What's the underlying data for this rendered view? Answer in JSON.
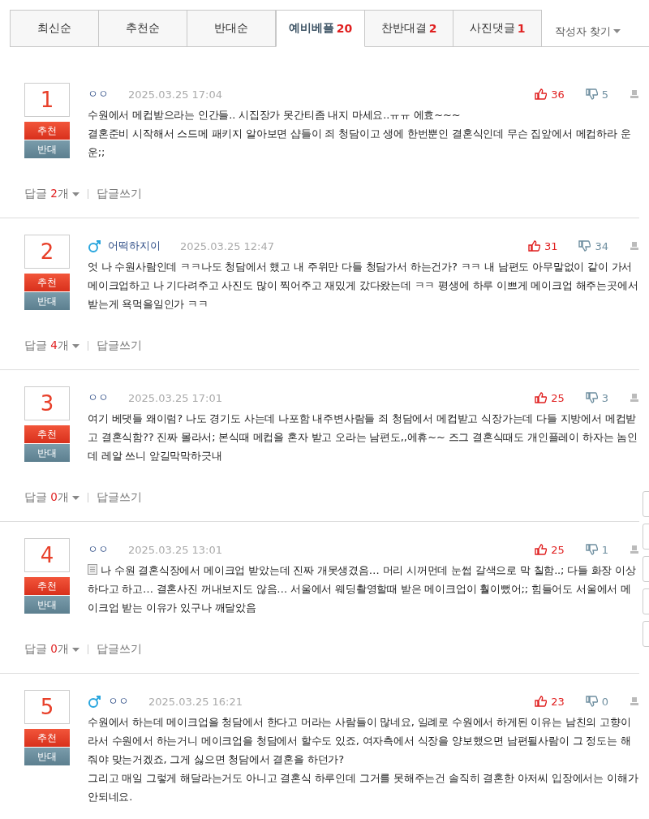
{
  "tabs": [
    {
      "label": "최신순",
      "selected": false
    },
    {
      "label": "추천순",
      "selected": false
    },
    {
      "label": "반대순",
      "selected": false
    },
    {
      "label": "예비베플",
      "count": "20",
      "selected": true
    },
    {
      "label": "찬반대결",
      "count": "2",
      "selected": false
    },
    {
      "label": "사진댓글",
      "count": "1",
      "selected": false
    }
  ],
  "author_search": {
    "label": "작성자 찾기"
  },
  "comments": [
    {
      "rank": "1",
      "upvote_label": "추천",
      "downvote_label": "반대",
      "male": false,
      "nickname": "ㅇㅇ",
      "date": "2025.03.25 17:04",
      "likes": "36",
      "dislikes": "5",
      "attachment": false,
      "paragraphs": [
        "수원에서 메컵받으라는 인간들.. 시집장가 못간티좀 내지 마세요..ㅠㅠ 에효~~~",
        "결혼준비 시작해서 스드메 패키지 알아보면 샵들이 죄 청담이고 생에 한번뿐인 결혼식인데 무슨 집앞에서 메컵하라 운운;;"
      ],
      "reply_label": "답글",
      "reply_count": "2",
      "reply_unit": "개",
      "write_reply": "답글쓰기"
    },
    {
      "rank": "2",
      "upvote_label": "추천",
      "downvote_label": "반대",
      "male": true,
      "nickname": "어떡하지이",
      "date": "2025.03.25 12:47",
      "likes": "31",
      "dislikes": "34",
      "attachment": false,
      "paragraphs": [
        "엇 나 수원사람인데 ㅋㅋ나도 청담에서 했고 내 주위만 다들 청담가서 하는건가? ㅋㅋ 내 남편도 아무말없이 같이 가서 메이크업하고 나 기다려주고 사진도 많이 찍어주고 재밌게 갔다왔는데 ㅋㅋ 평생에 하루 이쁘게 메이크업 해주는곳에서 받는게 욕먹을일인가 ㅋㅋ"
      ],
      "reply_label": "답글",
      "reply_count": "4",
      "reply_unit": "개",
      "write_reply": "답글쓰기"
    },
    {
      "rank": "3",
      "upvote_label": "추천",
      "downvote_label": "반대",
      "male": false,
      "nickname": "ㅇㅇ",
      "date": "2025.03.25 17:01",
      "likes": "25",
      "dislikes": "3",
      "attachment": false,
      "paragraphs": [
        "여기 베댓들 왜이럼? 나도 경기도 사는데 나포함 내주변사람들 죄 청담에서 메컵받고 식장가는데 다들 지방에서 메컵받고 결혼식함?? 진짜 몰라서; 본식때 메컵을 혼자 받고 오라는 남편도,,에휴~~ 즈그 결혼식때도 개인플레이 하자는 놈인데 레알 쓰니 앞길막막하긋내"
      ],
      "reply_label": "답글",
      "reply_count": "0",
      "reply_unit": "개",
      "write_reply": "답글쓰기"
    },
    {
      "rank": "4",
      "upvote_label": "추천",
      "downvote_label": "반대",
      "male": false,
      "nickname": "ㅇㅇ",
      "date": "2025.03.25 13:01",
      "likes": "25",
      "dislikes": "1",
      "attachment": true,
      "paragraphs": [
        "나 수원 결혼식장에서 메이크업 받았는데 진짜 개못생겼음… 머리 시꺼먼데 눈썹 갈색으로 막 칠함..; 다들 화장 이상하다고 하고… 결혼사진 꺼내보지도 않음… 서울에서 웨딩촬영할때 받은 메이크업이 훨이뻤어;; 힘들어도 서울에서 메이크업 받는 이유가 있구나 깨달았음"
      ],
      "reply_label": "답글",
      "reply_count": "0",
      "reply_unit": "개",
      "write_reply": "답글쓰기"
    },
    {
      "rank": "5",
      "upvote_label": "추천",
      "downvote_label": "반대",
      "male": true,
      "nickname": "ㅇㅇ",
      "date": "2025.03.25 16:21",
      "likes": "23",
      "dislikes": "0",
      "attachment": false,
      "paragraphs": [
        "수원에서 하는데 메이크업을 청담에서 한다고 머라는 사람들이 많네요, 일례로 수원에서 하게된 이유는 남친의 고향이라서 수원에서 하는거니 메이크업을 청담에서 할수도 있죠, 여자측에서 식장을 양보했으면 남편될사람이 그 정도는 해줘야 맞는거겠죠, 그게 싫으면 청담에서 결혼을 하던가?",
        "그리고 매일 그렇게 해달라는거도 아니고 결혼식 하루인데 그거를 못해주는건 솔직히 결혼한 아저씨 입장에서는 이해가 안되네요."
      ]
    }
  ]
}
